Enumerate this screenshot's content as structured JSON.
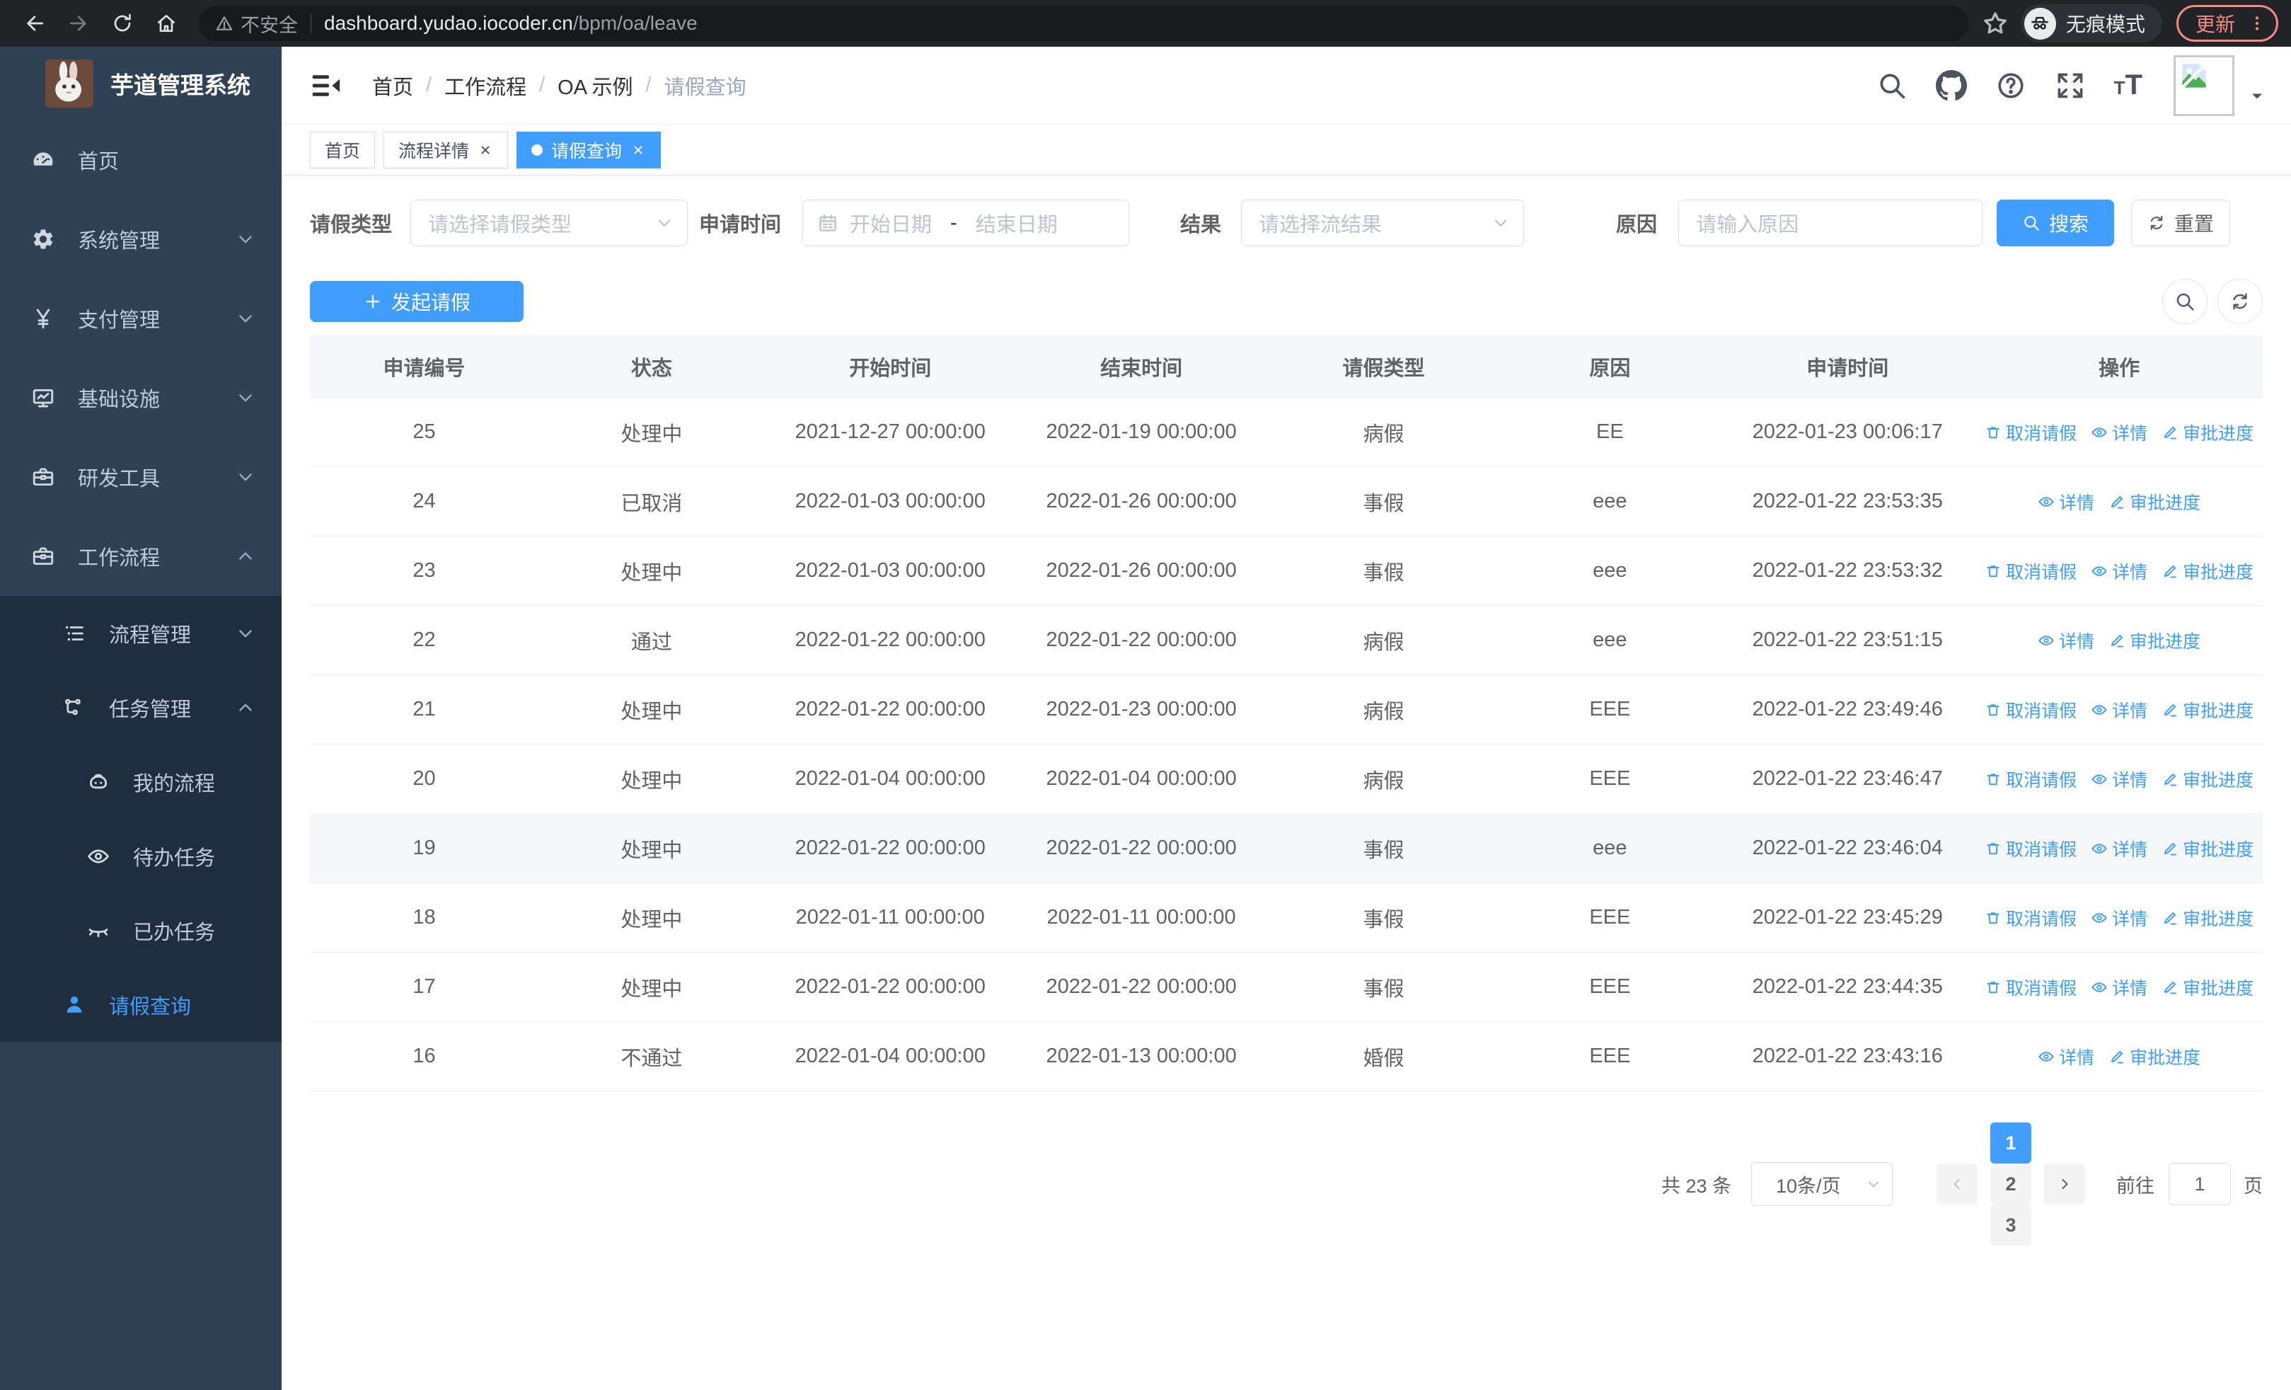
{
  "browser": {
    "security_label": "不安全",
    "url_host": "dashboard.yudao.iocoder.cn",
    "url_path": "/bpm/oa/leave",
    "incognito_label": "无痕模式",
    "update_label": "更新"
  },
  "colors": {
    "accent": "#409eff",
    "sidebar_bg": "#304156",
    "submenu_bg": "#1f2d3d",
    "sidebar_text": "#bfcbd9",
    "chrome_bg": "#222327",
    "update_accent": "#f28b82",
    "table_header_bg": "#f5f7fa",
    "highlight_row_bg": "#f5f7fa"
  },
  "sidebar": {
    "app_title": "芋道管理系统",
    "items": [
      {
        "label": "首页",
        "icon": "dashboard-icon",
        "level": 1,
        "submenu": false,
        "active": false,
        "chevron": ""
      },
      {
        "label": "系统管理",
        "icon": "gear-icon",
        "level": 1,
        "submenu": false,
        "active": false,
        "chevron": "down"
      },
      {
        "label": "支付管理",
        "icon": "yen-icon",
        "level": 1,
        "submenu": false,
        "active": false,
        "chevron": "down"
      },
      {
        "label": "基础设施",
        "icon": "monitor-icon",
        "level": 1,
        "submenu": false,
        "active": false,
        "chevron": "down"
      },
      {
        "label": "研发工具",
        "icon": "toolbox-icon",
        "level": 1,
        "submenu": false,
        "active": false,
        "chevron": "down"
      },
      {
        "label": "工作流程",
        "icon": "toolbox-icon",
        "level": 1,
        "submenu": false,
        "active": false,
        "chevron": "up"
      },
      {
        "label": "流程管理",
        "icon": "list-tree-icon",
        "level": 2,
        "submenu": true,
        "active": false,
        "chevron": "down"
      },
      {
        "label": "任务管理",
        "icon": "flow-tree-icon",
        "level": 2,
        "submenu": true,
        "active": false,
        "chevron": "up"
      },
      {
        "label": "我的流程",
        "icon": "robot-icon",
        "level": 3,
        "submenu": true,
        "active": false,
        "chevron": ""
      },
      {
        "label": "待办任务",
        "icon": "eye-icon",
        "level": 3,
        "submenu": true,
        "active": false,
        "chevron": ""
      },
      {
        "label": "已办任务",
        "icon": "eye-closed-icon",
        "level": 3,
        "submenu": true,
        "active": false,
        "chevron": ""
      },
      {
        "label": "请假查询",
        "icon": "person-icon",
        "level": 2,
        "submenu": true,
        "active": true,
        "chevron": ""
      }
    ]
  },
  "header": {
    "breadcrumbs": [
      "首页",
      "工作流程",
      "OA 示例",
      "请假查询"
    ]
  },
  "tabs": [
    {
      "label": "首页",
      "closable": false,
      "active": false
    },
    {
      "label": "流程详情",
      "closable": true,
      "active": false
    },
    {
      "label": "请假查询",
      "closable": true,
      "active": true
    }
  ],
  "filters": {
    "leave_type": {
      "label": "请假类型",
      "placeholder": "请选择请假类型"
    },
    "apply_time": {
      "label": "申请时间",
      "start_placeholder": "开始日期",
      "separator": "-",
      "end_placeholder": "结束日期"
    },
    "result": {
      "label": "结果",
      "placeholder": "请选择流结果"
    },
    "reason": {
      "label": "原因",
      "placeholder": "请输入原因"
    },
    "search_label": "搜索",
    "reset_label": "重置"
  },
  "toolbar": {
    "create_label": "发起请假"
  },
  "table": {
    "columns": [
      "申请编号",
      "状态",
      "开始时间",
      "结束时间",
      "请假类型",
      "原因",
      "申请时间",
      "操作"
    ],
    "action_labels": {
      "cancel": "取消请假",
      "detail": "详情",
      "progress": "审批进度"
    },
    "rows": [
      {
        "id": "25",
        "status": "处理中",
        "start": "2021-12-27 00:00:00",
        "end": "2022-01-19 00:00:00",
        "type": "病假",
        "reason": "EE",
        "applied": "2022-01-23 00:06:17",
        "actions": [
          "cancel",
          "detail",
          "progress"
        ],
        "highlight": false
      },
      {
        "id": "24",
        "status": "已取消",
        "start": "2022-01-03 00:00:00",
        "end": "2022-01-26 00:00:00",
        "type": "事假",
        "reason": "eee",
        "applied": "2022-01-22 23:53:35",
        "actions": [
          "detail",
          "progress"
        ],
        "highlight": false
      },
      {
        "id": "23",
        "status": "处理中",
        "start": "2022-01-03 00:00:00",
        "end": "2022-01-26 00:00:00",
        "type": "事假",
        "reason": "eee",
        "applied": "2022-01-22 23:53:32",
        "actions": [
          "cancel",
          "detail",
          "progress"
        ],
        "highlight": false
      },
      {
        "id": "22",
        "status": "通过",
        "start": "2022-01-22 00:00:00",
        "end": "2022-01-22 00:00:00",
        "type": "病假",
        "reason": "eee",
        "applied": "2022-01-22 23:51:15",
        "actions": [
          "detail",
          "progress"
        ],
        "highlight": false
      },
      {
        "id": "21",
        "status": "处理中",
        "start": "2022-01-22 00:00:00",
        "end": "2022-01-23 00:00:00",
        "type": "病假",
        "reason": "EEE",
        "applied": "2022-01-22 23:49:46",
        "actions": [
          "cancel",
          "detail",
          "progress"
        ],
        "highlight": false
      },
      {
        "id": "20",
        "status": "处理中",
        "start": "2022-01-04 00:00:00",
        "end": "2022-01-04 00:00:00",
        "type": "病假",
        "reason": "EEE",
        "applied": "2022-01-22 23:46:47",
        "actions": [
          "cancel",
          "detail",
          "progress"
        ],
        "highlight": false
      },
      {
        "id": "19",
        "status": "处理中",
        "start": "2022-01-22 00:00:00",
        "end": "2022-01-22 00:00:00",
        "type": "事假",
        "reason": "eee",
        "applied": "2022-01-22 23:46:04",
        "actions": [
          "cancel",
          "detail",
          "progress"
        ],
        "highlight": true
      },
      {
        "id": "18",
        "status": "处理中",
        "start": "2022-01-11 00:00:00",
        "end": "2022-01-11 00:00:00",
        "type": "事假",
        "reason": "EEE",
        "applied": "2022-01-22 23:45:29",
        "actions": [
          "cancel",
          "detail",
          "progress"
        ],
        "highlight": false
      },
      {
        "id": "17",
        "status": "处理中",
        "start": "2022-01-22 00:00:00",
        "end": "2022-01-22 00:00:00",
        "type": "事假",
        "reason": "EEE",
        "applied": "2022-01-22 23:44:35",
        "actions": [
          "cancel",
          "detail",
          "progress"
        ],
        "highlight": false
      },
      {
        "id": "16",
        "status": "不通过",
        "start": "2022-01-04 00:00:00",
        "end": "2022-01-13 00:00:00",
        "type": "婚假",
        "reason": "EEE",
        "applied": "2022-01-22 23:43:16",
        "actions": [
          "detail",
          "progress"
        ],
        "highlight": false
      }
    ]
  },
  "pagination": {
    "total_label": "共 23 条",
    "page_size_label": "10条/页",
    "pages": [
      "1",
      "2",
      "3"
    ],
    "active_page": "1",
    "goto_label": "前往",
    "goto_value": "1",
    "page_suffix": "页"
  }
}
